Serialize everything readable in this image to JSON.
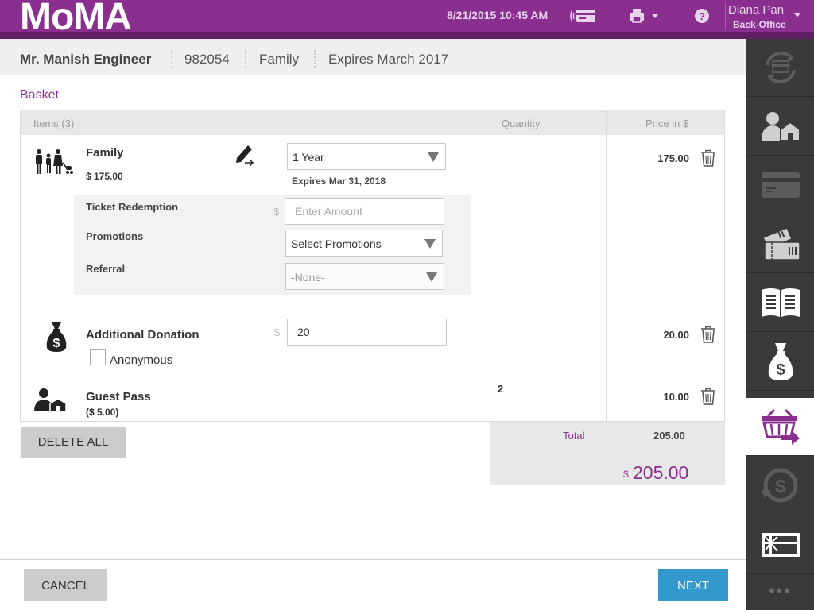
{
  "header": {
    "logo": "MoMA",
    "datetime": "8/21/2015 10:45 AM",
    "user_name": "Diana Pan",
    "user_role": "Back-Office",
    "brand_color": "#8a2f90"
  },
  "member": {
    "name": "Mr. Manish Engineer",
    "id": "982054",
    "type": "Family",
    "expires": "Expires March 2017"
  },
  "basket": {
    "title": "Basket",
    "columns": {
      "items": "Items (3)",
      "quantity": "Quantity",
      "price": "Price in $"
    },
    "family": {
      "name": "Family",
      "price_sub": "$ 175.00",
      "term": "1 Year",
      "expires": "Expires Mar 31, 2018",
      "price": "175.00",
      "ticket_label": "Ticket Redemption",
      "ticket_currency": "$",
      "ticket_placeholder": "Enter Amount",
      "promotions_label": "Promotions",
      "promotions_value": "Select Promotions",
      "referral_label": "Referral",
      "referral_value": "-None-"
    },
    "donation": {
      "name": "Additional Donation",
      "currency": "$",
      "amount": "20",
      "anonymous_label": "Anonymous",
      "price": "20.00"
    },
    "guest": {
      "name": "Guest Pass",
      "price_sub": "($ 5.00)",
      "quantity": "2",
      "price": "10.00"
    },
    "delete_all": "DELETE ALL",
    "total_label": "Total",
    "total_value": "205.00",
    "grand_currency": "$",
    "grand_total": "205.00"
  },
  "footer": {
    "cancel": "CANCEL",
    "next": "NEXT"
  },
  "rail": {
    "items": [
      "sync-card-icon",
      "member-home-icon",
      "card-icon",
      "tickets-icon",
      "catalog-icon",
      "money-bag-icon",
      "basket-forward-icon",
      "refund-icon",
      "gift-card-icon"
    ],
    "more": "•••"
  }
}
